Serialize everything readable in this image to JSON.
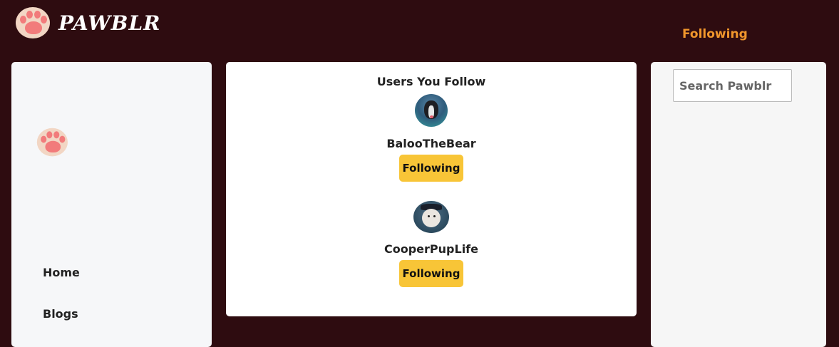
{
  "header": {
    "logo_text": "PAWBLR",
    "nav_following": "Following"
  },
  "sidebar": {
    "items": [
      {
        "label": "Home"
      },
      {
        "label": "Blogs"
      }
    ]
  },
  "search": {
    "placeholder": "Search Pawblr"
  },
  "main": {
    "title": "Users You Follow",
    "users": [
      {
        "username": "BalooTheBear",
        "button_label": "Following"
      },
      {
        "username": "CooperPupLife",
        "button_label": "Following"
      }
    ]
  },
  "colors": {
    "background": "#2e0c10",
    "accent_nav": "#f0962c",
    "button": "#f8c537",
    "panel": "#f6f7f9"
  }
}
